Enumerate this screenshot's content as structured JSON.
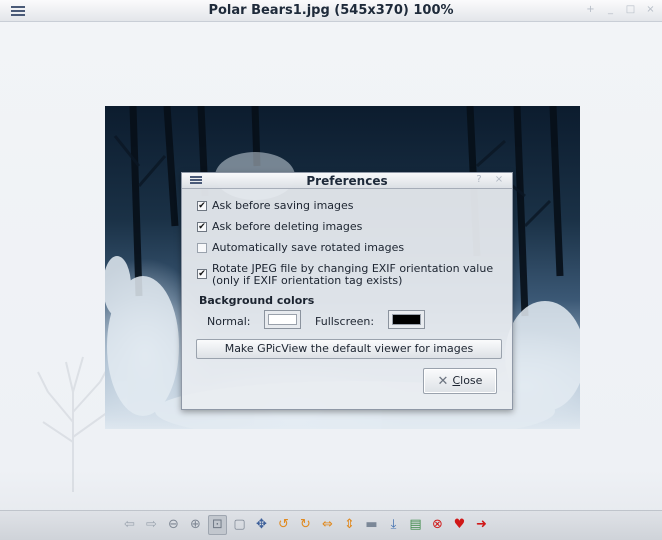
{
  "window": {
    "title": "Polar Bears1.jpg (545x370) 100%",
    "controls": [
      "+",
      "_",
      "□",
      "×"
    ]
  },
  "dialog": {
    "title": "Preferences",
    "controls": [
      "?",
      "×"
    ],
    "options": [
      {
        "label": "Ask before saving images",
        "checked": true
      },
      {
        "label": "Ask before deleting images",
        "checked": true
      },
      {
        "label": "Automatically save rotated images",
        "checked": false
      },
      {
        "label": "Rotate JPEG file by changing EXIF orientation value",
        "label2": "(only if EXIF orientation tag exists)",
        "checked": true
      }
    ],
    "background_colors": {
      "heading": "Background colors",
      "normal_label": "Normal:",
      "normal_color": "#ffffff",
      "fullscreen_label": "Fullscreen:",
      "fullscreen_color": "#000000"
    },
    "default_viewer_button": "Make GPicView the default viewer for images",
    "close_button": {
      "mnemonic": "C",
      "rest": "lose"
    }
  },
  "toolbar": {
    "buttons": [
      {
        "name": "previous-icon",
        "glyph": "⇦",
        "color": "#9aa3ae"
      },
      {
        "name": "next-icon",
        "glyph": "⇨",
        "color": "#9aa3ae"
      },
      {
        "name": "zoom-out-icon",
        "glyph": "⊖",
        "color": "#7e8794"
      },
      {
        "name": "zoom-in-icon",
        "glyph": "⊕",
        "color": "#7e8794"
      },
      {
        "name": "zoom-fit-icon",
        "glyph": "⊡",
        "color": "#6e7784",
        "pressed": true
      },
      {
        "name": "zoom-original-icon",
        "glyph": "▢",
        "color": "#7e8794"
      },
      {
        "name": "fullscreen-icon",
        "glyph": "✥",
        "color": "#3d5f9a"
      },
      {
        "name": "rotate-left-icon",
        "glyph": "↺",
        "color": "#e0891f"
      },
      {
        "name": "rotate-right-icon",
        "glyph": "↻",
        "color": "#e0891f"
      },
      {
        "name": "flip-horizontal-icon",
        "glyph": "⇔",
        "color": "#e0891f"
      },
      {
        "name": "flip-vertical-icon",
        "glyph": "⇕",
        "color": "#e0891f"
      },
      {
        "name": "open-file-icon",
        "glyph": "▬",
        "color": "#7b8797"
      },
      {
        "name": "save-file-icon",
        "glyph": "⤓",
        "color": "#3f6fb0"
      },
      {
        "name": "save-as-icon",
        "glyph": "▤",
        "color": "#3f8a4a"
      },
      {
        "name": "delete-icon",
        "glyph": "⊗",
        "color": "#d01818"
      },
      {
        "name": "preferences-icon",
        "glyph": "♥",
        "color": "#d01818"
      },
      {
        "name": "quit-icon",
        "glyph": "➜",
        "color": "#d01818"
      }
    ]
  }
}
